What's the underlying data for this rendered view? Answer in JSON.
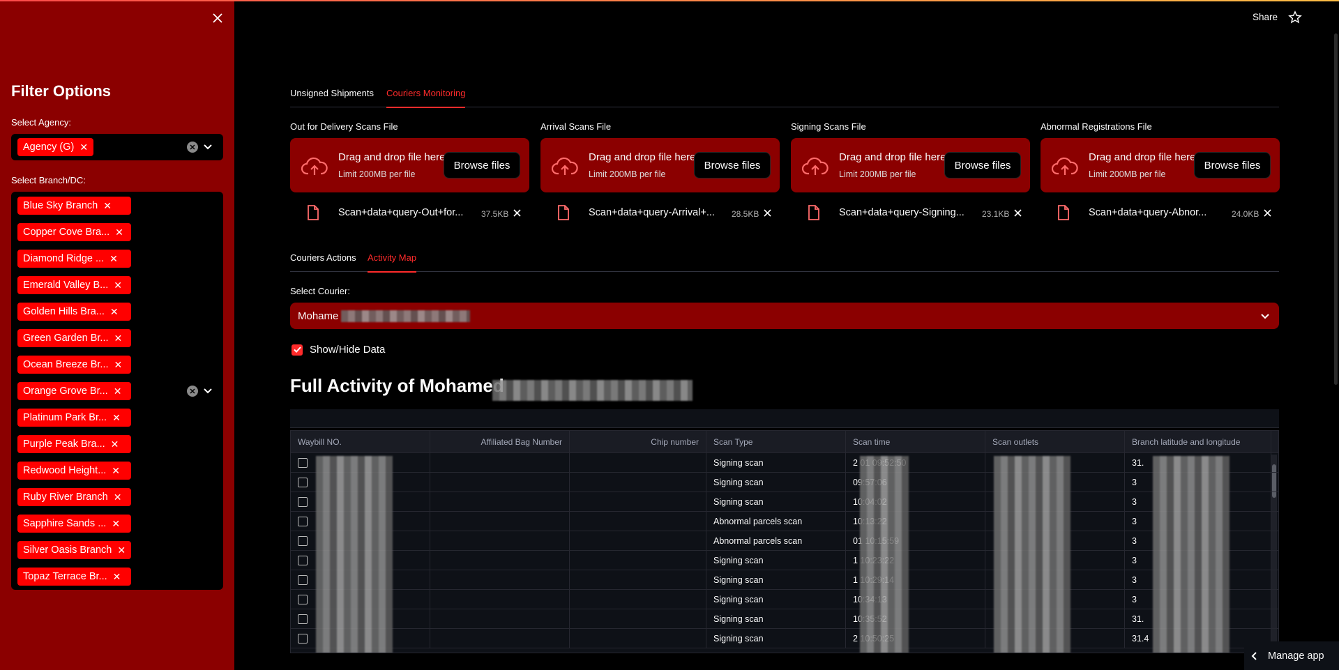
{
  "header": {
    "share_label": "Share"
  },
  "sidebar": {
    "title": "Filter Options",
    "agency_label": "Select Agency:",
    "agency_selected": [
      "Agency (G)"
    ],
    "branch_label": "Select Branch/DC:",
    "branch_selected": [
      "Blue Sky Branch",
      "Copper Cove Bra...",
      "Diamond Ridge ...",
      "Emerald Valley B...",
      "Golden Hills Bra...",
      "Green Garden Br...",
      "Ocean Breeze Br...",
      "Orange Grove Br...",
      "Platinum Park Br...",
      "Purple Peak Bra...",
      "Redwood Height...",
      "Ruby River Branch",
      "Sapphire Sands ...",
      "Silver Oasis Branch",
      "Topaz Terrace Br..."
    ]
  },
  "main_tabs": [
    {
      "label": "Unsigned Shipments",
      "active": false
    },
    {
      "label": "Couriers Monitoring",
      "active": true
    }
  ],
  "uploaders": [
    {
      "label": "Out for Delivery Scans File",
      "drop_text": "Drag and drop file here",
      "limit": "Limit 200MB per file",
      "button": "Browse files",
      "file_name": "Scan+data+query-Out+for...",
      "file_size": "37.5KB"
    },
    {
      "label": "Arrival Scans File",
      "drop_text": "Drag and drop file here",
      "limit": "Limit 200MB per file",
      "button": "Browse files",
      "file_name": "Scan+data+query-Arrival+...",
      "file_size": "28.5KB"
    },
    {
      "label": "Signing Scans File",
      "drop_text": "Drag and drop file here",
      "limit": "Limit 200MB per file",
      "button": "Browse files",
      "file_name": "Scan+data+query-Signing...",
      "file_size": "23.1KB"
    },
    {
      "label": "Abnormal Registrations File",
      "drop_text": "Drag and drop file here",
      "limit": "Limit 200MB per file",
      "button": "Browse files",
      "file_name": "Scan+data+query-Abnor...",
      "file_size": "24.0KB"
    }
  ],
  "sub_tabs": [
    {
      "label": "Couriers Actions",
      "active": false
    },
    {
      "label": "Activity Map",
      "active": true
    }
  ],
  "courier": {
    "label": "Select Courier:",
    "value": "Mohame"
  },
  "show_hide": {
    "label": "Show/Hide Data",
    "checked": true
  },
  "heading": "Full Activity of Mohamed",
  "table": {
    "columns": [
      "Waybill NO.",
      "Affiliated Bag Number",
      "Chip number",
      "Scan Type",
      "Scan time",
      "Scan outlets",
      "Branch latitude and longitude"
    ],
    "rows": [
      {
        "scan_type": "Signing scan",
        "scan_time": "2        01 09:52:50",
        "latlng": "31."
      },
      {
        "scan_type": "Signing scan",
        "scan_time": "09:57:06",
        "latlng": "3"
      },
      {
        "scan_type": "Signing scan",
        "scan_time": "10:04:02",
        "latlng": "3"
      },
      {
        "scan_type": "Abnormal parcels scan",
        "scan_time": "10:13:22",
        "latlng": "3"
      },
      {
        "scan_type": "Abnormal parcels scan",
        "scan_time": "01 10:15:59",
        "latlng": "3"
      },
      {
        "scan_type": "Signing scan",
        "scan_time": "1 10:23:22",
        "latlng": "3"
      },
      {
        "scan_type": "Signing scan",
        "scan_time": "1 10:29:14",
        "latlng": "3"
      },
      {
        "scan_type": "Signing scan",
        "scan_time": "10:34:13",
        "latlng": "3"
      },
      {
        "scan_type": "Signing scan",
        "scan_time": "10:35:52",
        "latlng": "31."
      },
      {
        "scan_type": "Signing scan",
        "scan_time": "2        10:50:25",
        "latlng": "31.4"
      }
    ]
  },
  "manage_app": "Manage app",
  "colors": {
    "sidebar_bg": "#8b0000",
    "accent": "#ff2b2b",
    "chip": "#ff0000",
    "background": "#000000"
  }
}
